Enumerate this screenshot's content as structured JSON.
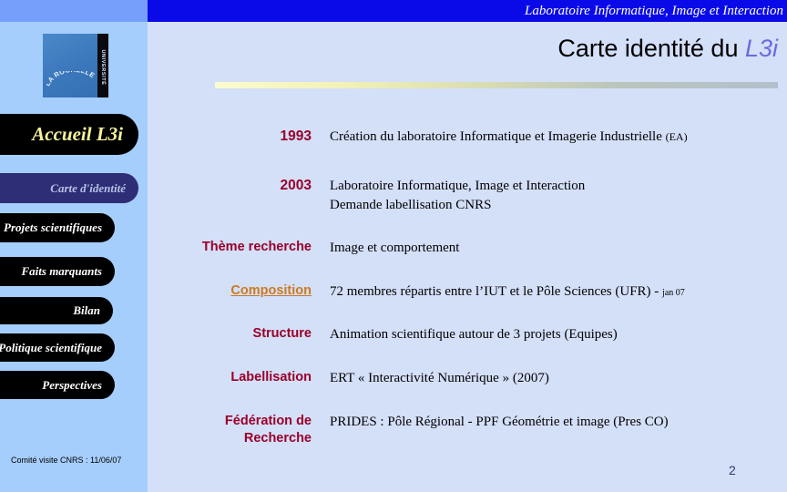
{
  "banner": {
    "text": "Laboratoire Informatique, Image et Interaction"
  },
  "title": {
    "main": "Carte identité du ",
    "accent": "L3i"
  },
  "sidebar": {
    "logo": {
      "arc_text": "LA ROCHELLE",
      "bar_text": "UNIVERSITÉ"
    },
    "items": [
      {
        "label": "Accueil L3i"
      },
      {
        "label": "Carte d'identité"
      },
      {
        "label": "Projets scientifiques"
      },
      {
        "label": "Faits marquants"
      },
      {
        "label": "Bilan"
      },
      {
        "label": "Politique scientifique"
      },
      {
        "label": "Perspectives"
      }
    ],
    "footer": "Comité visite CNRS : 11/06/07"
  },
  "rows": [
    {
      "label": "1993",
      "value_main": "Création du laboratoire Informatique et Imagerie Industrielle ",
      "value_small": "(EA)",
      "value_line2": ""
    },
    {
      "label": "2003",
      "value_main": "Laboratoire Informatique, Image et Interaction",
      "value_small": "",
      "value_line2": "Demande labellisation CNRS"
    },
    {
      "label": "Thème recherche",
      "value_main": "Image et comportement",
      "value_small": "",
      "value_line2": ""
    },
    {
      "label": "Composition",
      "value_main": "72 membres répartis entre l’IUT et le Pôle Sciences (UFR) - ",
      "value_small": "jan 07",
      "value_line2": ""
    },
    {
      "label": "Structure",
      "value_main": "Animation scientifique autour de 3 projets (Equipes)",
      "value_small": "",
      "value_line2": ""
    },
    {
      "label": "Labellisation",
      "value_main": "ERT « Interactivité Numérique » (2007)",
      "value_small": "",
      "value_line2": ""
    },
    {
      "label_line1": "Fédération de",
      "label_line2": "Recherche",
      "value_main": "PRIDES : Pôle Régional - PPF Géométrie et image (Pres CO)",
      "value_small": "",
      "value_line2": ""
    }
  ],
  "page_number": "2",
  "colors": {
    "banner_blue": "#0a0ae8",
    "sidebar_blue": "#a5cefc",
    "sidebar_strip": "#769ffc",
    "main_bg": "#d4dff8",
    "label_maroon": "#99002a",
    "link_orange": "#cc7a22",
    "active_nav": "#2e2e77",
    "home_yellow": "#f6f39a",
    "title_accent": "#6a6ae0"
  }
}
